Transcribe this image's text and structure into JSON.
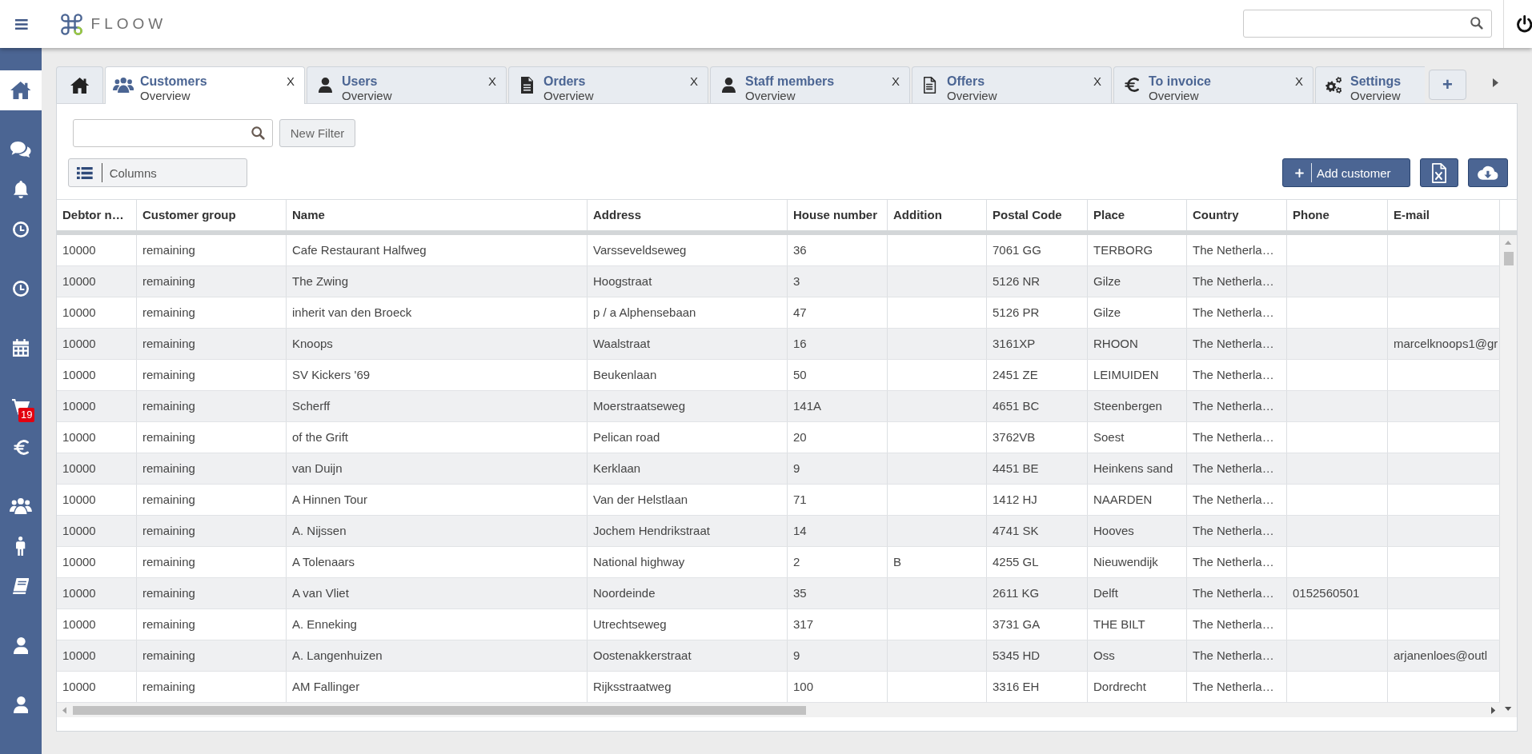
{
  "top_bar": {
    "logo_text": "FLOOW"
  },
  "sidebar": {
    "groups": [
      {
        "items": [
          {
            "selected": true
          }
        ]
      },
      {
        "items": [
          {
            "selected": false
          },
          {
            "selected": false
          },
          {
            "selected": false
          }
        ]
      },
      {
        "items": [
          {
            "selected": false
          }
        ]
      },
      {
        "items": [
          {
            "selected": false
          }
        ]
      },
      {
        "items": [
          {
            "selected": false,
            "badge": "19"
          },
          {
            "selected": false
          }
        ]
      },
      {
        "items": [
          {
            "selected": false
          },
          {
            "selected": false
          },
          {
            "selected": false
          }
        ]
      },
      {
        "items": [
          {
            "selected": false
          }
        ]
      },
      {
        "items": [
          {
            "selected": false
          }
        ]
      }
    ]
  },
  "tabs": [
    {
      "kind": "home",
      "selected": false
    },
    {
      "kind": "page",
      "title": "Customers",
      "subtitle": "Overview",
      "close": "X",
      "selected": true
    },
    {
      "kind": "page",
      "title": "Users",
      "subtitle": "Overview",
      "close": "X",
      "selected": false
    },
    {
      "kind": "page",
      "title": "Orders",
      "subtitle": "Overview",
      "close": "X",
      "selected": false
    },
    {
      "kind": "page",
      "title": "Staff members",
      "subtitle": "Overview",
      "close": "X",
      "selected": false
    },
    {
      "kind": "page",
      "title": "Offers",
      "subtitle": "Overview",
      "close": "X",
      "selected": false
    },
    {
      "kind": "page",
      "title": "To invoice",
      "subtitle": "Overview",
      "close": "X",
      "selected": false
    },
    {
      "kind": "page",
      "title": "Settings",
      "subtitle": "Overview",
      "selected": false
    }
  ],
  "new_tab_button": "+",
  "toolbar": {
    "new_filter_button": "New Filter",
    "columns_button": "Columns",
    "add_button": "Add customer"
  },
  "table": {
    "columns": [
      "Debtor n…",
      "Customer group",
      "Name",
      "Address",
      "House number",
      "Addition",
      "Postal Code",
      "Place",
      "Country",
      "Phone",
      "E-mail"
    ],
    "rows": [
      [
        "10000",
        "remaining",
        "Cafe Restaurant Halfweg",
        "Varsseveldseweg",
        "36",
        null,
        "7061 GG",
        "TERBORG",
        "The Netherla…",
        null,
        null
      ],
      [
        "10000",
        "remaining",
        "The Zwing",
        "Hoogstraat",
        "3",
        null,
        "5126 NR",
        "Gilze",
        "The Netherla…",
        null,
        null
      ],
      [
        "10000",
        "remaining",
        "inherit van den Broeck",
        "p / a Alphensebaan",
        "47",
        null,
        "5126 PR",
        "Gilze",
        "The Netherla…",
        null,
        null
      ],
      [
        "10000",
        "remaining",
        "Knoops",
        "Waalstraat",
        "16",
        null,
        "3161XP",
        "RHOON",
        "The Netherla…",
        null,
        "marcelknoops1@gr"
      ],
      [
        "10000",
        "remaining",
        "SV Kickers '69",
        "Beukenlaan",
        "50",
        null,
        "2451 ZE",
        "LEIMUIDEN",
        "The Netherla…",
        null,
        null
      ],
      [
        "10000",
        "remaining",
        "Scherff",
        "Moerstraatseweg",
        "141A",
        null,
        "4651 BC",
        "Steenbergen",
        "The Netherla…",
        null,
        null
      ],
      [
        "10000",
        "remaining",
        "of the Grift",
        "Pelican road",
        "20",
        null,
        "3762VB",
        "Soest",
        "The Netherla…",
        null,
        null
      ],
      [
        "10000",
        "remaining",
        "van Duijn",
        "Kerklaan",
        "9",
        null,
        "4451 BE",
        "Heinkens sand",
        "The Netherla…",
        null,
        null
      ],
      [
        "10000",
        "remaining",
        "A Hinnen Tour",
        "Van der Helstlaan",
        "71",
        null,
        "1412 HJ",
        "NAARDEN",
        "The Netherla…",
        null,
        null
      ],
      [
        "10000",
        "remaining",
        "A. Nijssen",
        "Jochem Hendrikstraat",
        "14",
        null,
        "4741 SK",
        "Hooves",
        "The Netherla…",
        null,
        null
      ],
      [
        "10000",
        "remaining",
        "A Tolenaars",
        "National highway",
        "2",
        "B",
        "4255 GL",
        "Nieuwendijk",
        "The Netherla…",
        null,
        null
      ],
      [
        "10000",
        "remaining",
        "A van Vliet",
        "Noordeinde",
        "35",
        null,
        "2611 KG",
        "Delft",
        "The Netherla…",
        "0152560501",
        null
      ],
      [
        "10000",
        "remaining",
        "A. Enneking",
        "Utrechtseweg",
        "317",
        null,
        "3731 GA",
        "THE BILT",
        "The Netherla…",
        null,
        null
      ],
      [
        "10000",
        "remaining",
        "A. Langenhuizen",
        "Oostenakkerstraat",
        "9",
        null,
        "5345 HD",
        "Oss",
        "The Netherla…",
        null,
        "arjanenloes@outl"
      ],
      [
        "10000",
        "remaining",
        "AM Fallinger",
        "Rijksstraatweg",
        "100",
        null,
        "3316 EH",
        "Dordrecht",
        "The Netherla…",
        null,
        null
      ]
    ]
  }
}
